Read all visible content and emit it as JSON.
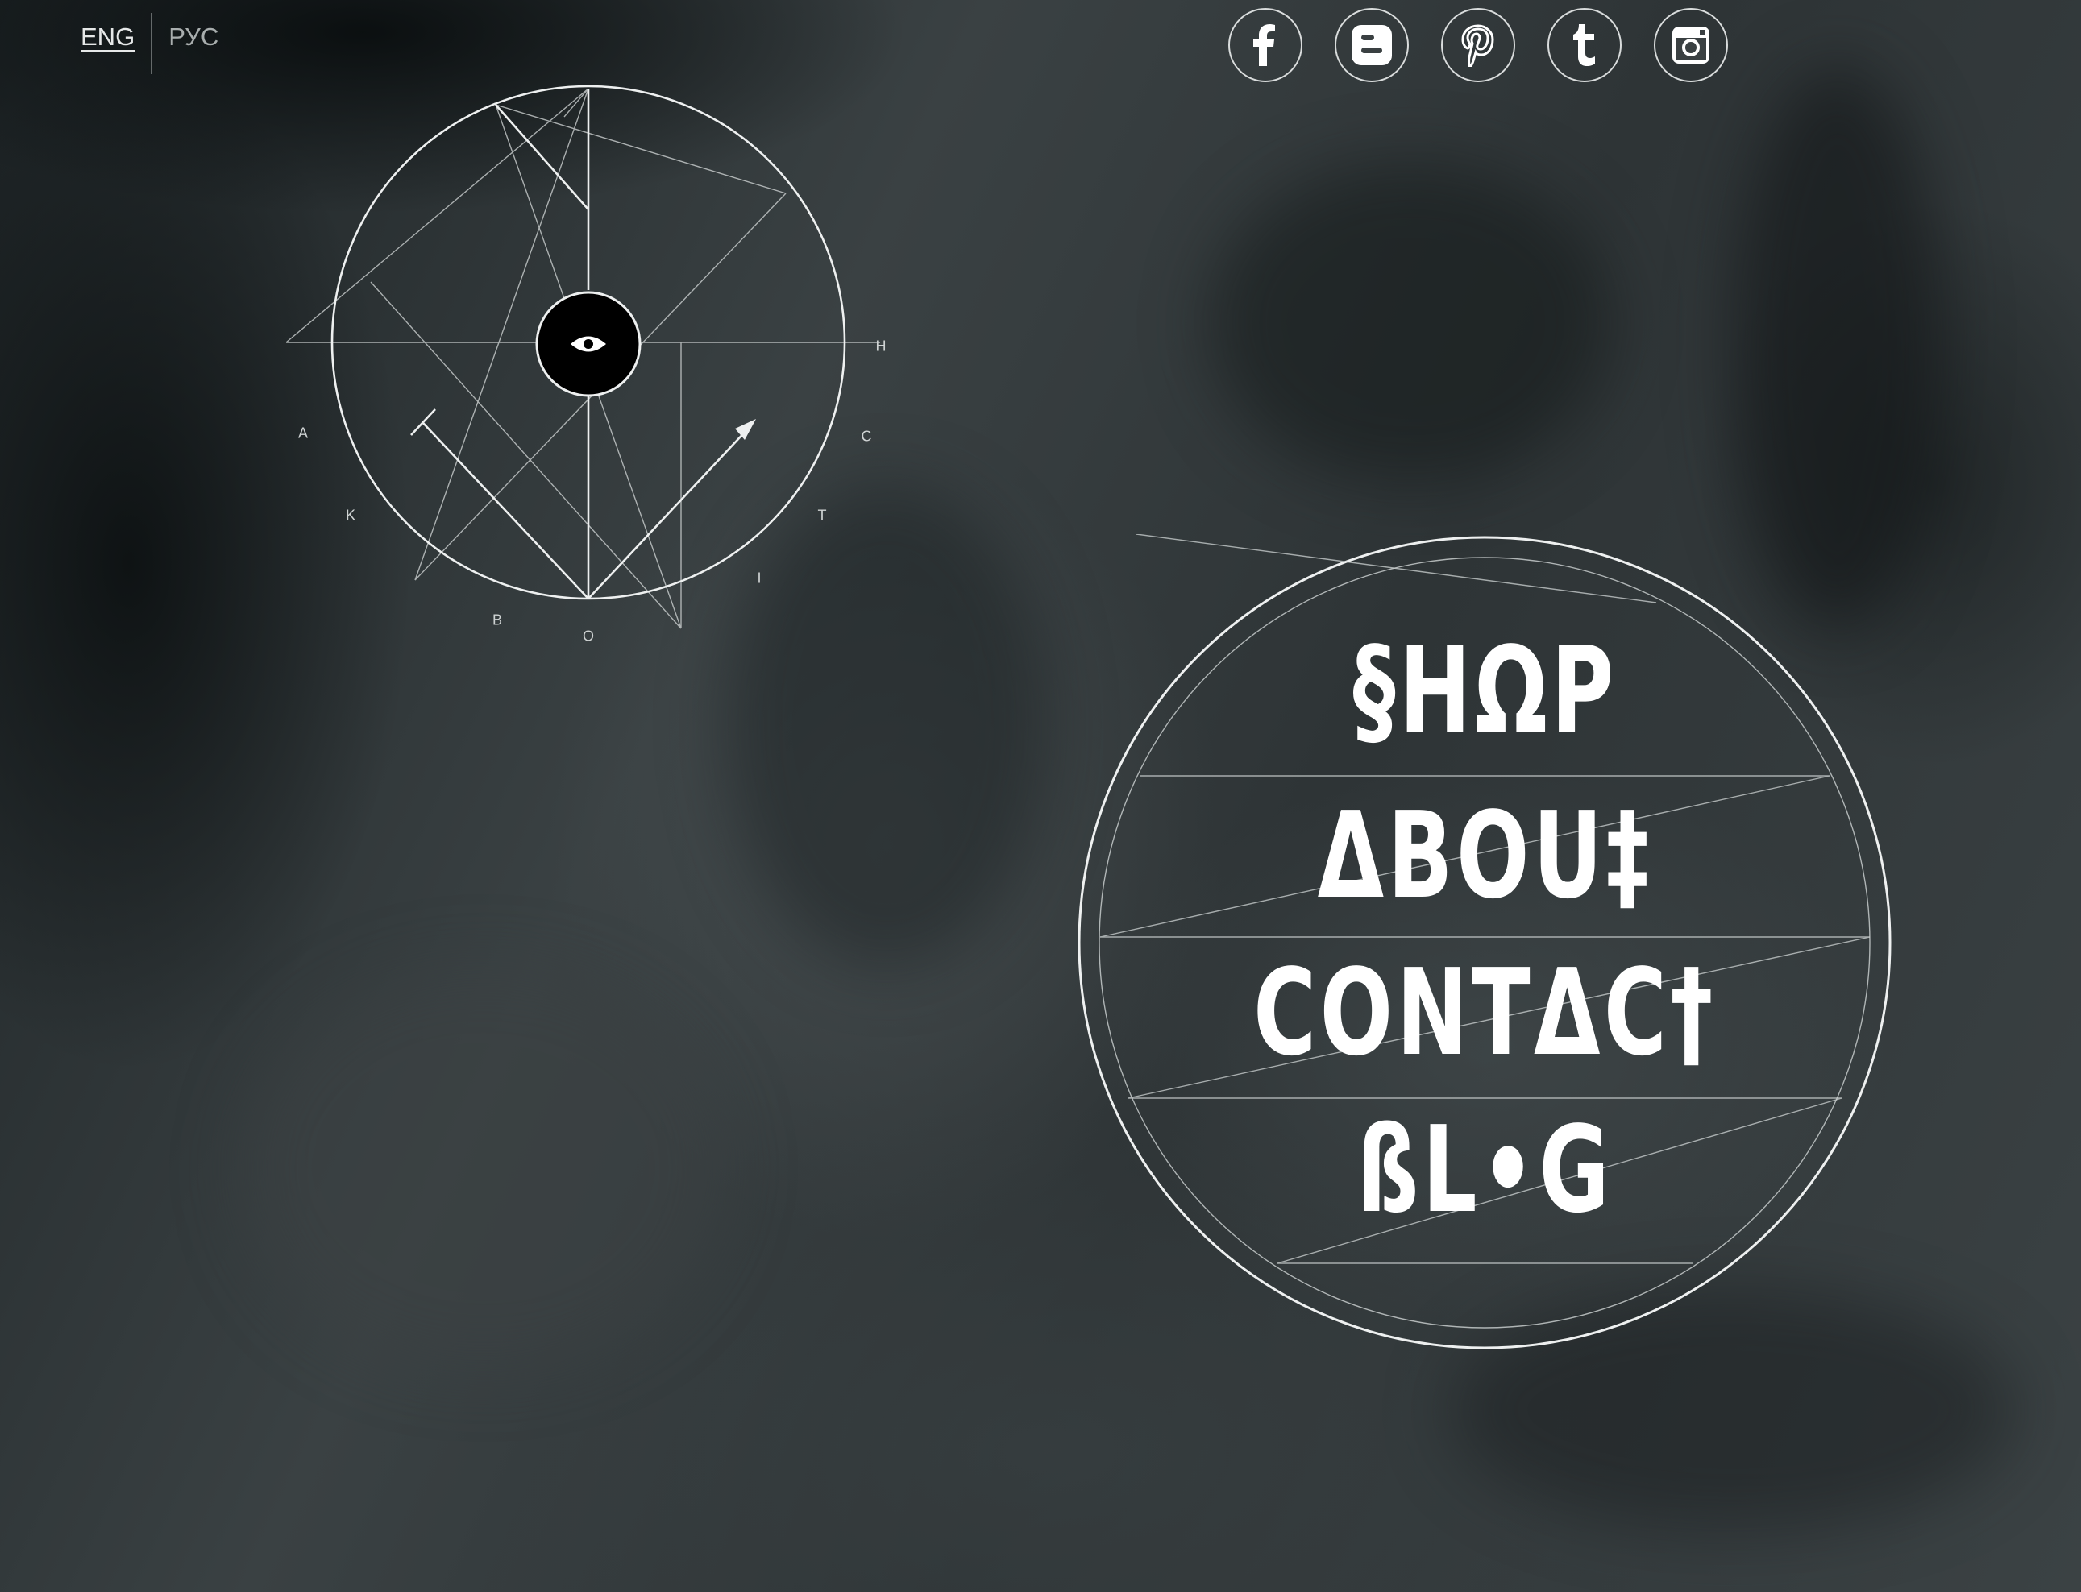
{
  "language": {
    "items": [
      {
        "label": "ENG",
        "active": true
      },
      {
        "label": "РУС",
        "active": false
      }
    ]
  },
  "social": {
    "items": [
      {
        "name": "facebook",
        "icon": "facebook-icon"
      },
      {
        "name": "blogger",
        "icon": "blogger-icon"
      },
      {
        "name": "pinterest",
        "icon": "pinterest-icon"
      },
      {
        "name": "tumblr",
        "icon": "tumblr-icon"
      },
      {
        "name": "instagram",
        "icon": "instagram-icon"
      }
    ]
  },
  "logo": {
    "letters": [
      "A",
      "K",
      "B",
      "O",
      "I",
      "T",
      "C",
      "H"
    ]
  },
  "nav": {
    "shop": "§HΩP",
    "about": "ΔBOU‡",
    "contact": "CONTΔC†",
    "blog": "ßL•G"
  },
  "colors": {
    "accent": "#ffffff",
    "background": "#2f3536"
  }
}
